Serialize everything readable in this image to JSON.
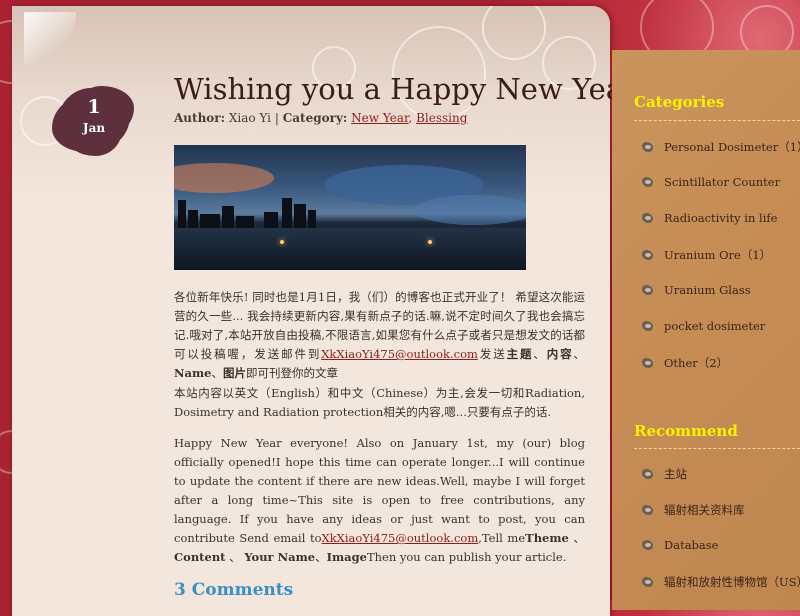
{
  "post": {
    "date_day": "1",
    "date_month": "Jan",
    "title": "Wishing you a Happy New Year!",
    "author_label": "Author:",
    "author": "Xiao Yi",
    "separator": "|",
    "category_label": "Category:",
    "categories": [
      "New Year",
      "Blessing"
    ],
    "photo_alt": "City skyline at dusk",
    "p1_a": "各位新年快乐! 同时也是1月1日，我（们）的博客也正式开业了！ 希望这次能运营的久一些... 我会持续更新内容,果有新点子的话.嘛,说不定时间久了我也会搞忘记.哦对了,本站开放自由投稿,不限语言,如果您有什么点子或者只是想发文的话都可以投稿喔，发送邮件到",
    "email": "XkXiaoYi475@outlook.com",
    "p1_b": "发送",
    "p1_theme": "主题",
    "p1_sep1": "、",
    "p1_content": "内容",
    "p1_sep2": "、",
    "p1_name": "Name",
    "p1_sep3": "、",
    "p1_image": "图片",
    "p1_c": "即可刊登你的文章",
    "p2": "本站内容以英文（English）和中文（Chinese）为主,会发一切和Radiation, Dosimetry and Radiation protection相关的内容,嗯...只要有点子的话.",
    "p3_a": "Happy New Year everyone! Also on January 1st, my (our) blog officially opened!I hope this time can operate longer...I will continue to update the content if there are new ideas.Well, maybe I will forget after a long time~This site is open to free contributions, any language. If you have any ideas or just want to post, you can contribute Send email to",
    "p3_b": ",Tell me",
    "p3_theme": "Theme",
    "p3_sep1": " 、",
    "p3_content": "Content",
    "p3_sep2": " 、",
    "p3_name": "Your Name",
    "p3_sep3": "、",
    "p3_image": "Image",
    "p3_c": "Then you can publish your article.",
    "comments_heading": "3 Comments"
  },
  "sidebar": {
    "categories_heading": "Categories",
    "categories": [
      "Personal Dosimeter（1）",
      "Scintillator Counter",
      "Radioactivity in life",
      "Uranium Ore（1）",
      "Uranium Glass",
      "pocket dosimeter",
      "Other（2）"
    ],
    "recommend_heading": "Recommend",
    "recommend": [
      "主站",
      "辐射相关资料库",
      "Database",
      "辐射和放射性博物馆（US）"
    ]
  },
  "colors": {
    "background_red": "#b52a36",
    "paper": "#f3e6dc",
    "title": "#3b1d18",
    "link": "#8b1d1d",
    "sidebar": "#c68d55",
    "sidebar_heading": "#fff200",
    "comments_heading": "#3a8fc6",
    "date_badge": "#5e2f3c"
  },
  "icons": {
    "sidebar_bullet": "ore-rock-icon"
  }
}
